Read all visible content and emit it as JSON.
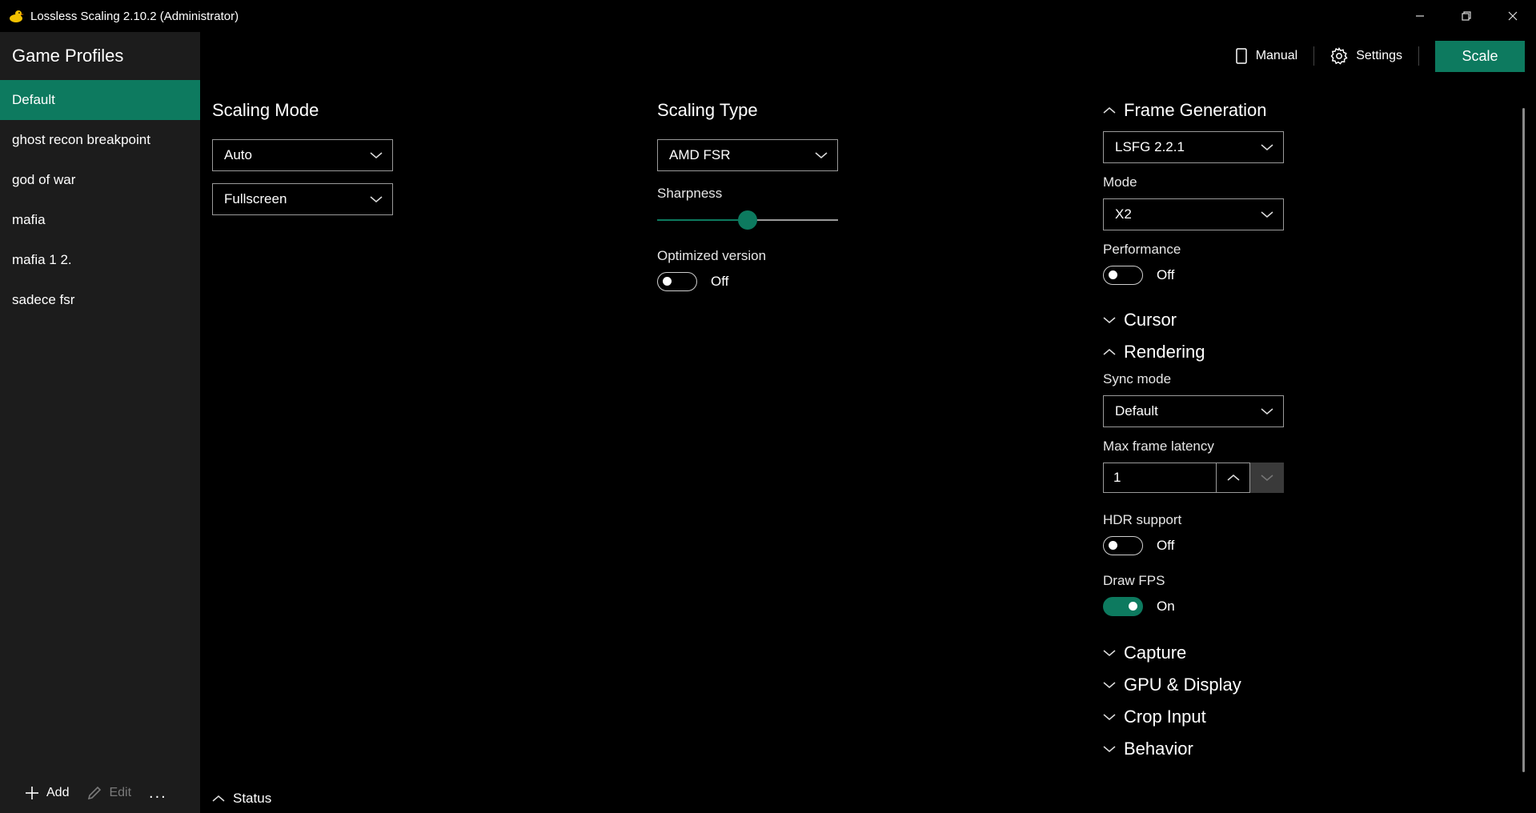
{
  "window": {
    "title": "Lossless Scaling 2.10.2 (Administrator)"
  },
  "sidebar": {
    "header": "Game Profiles",
    "profiles": [
      {
        "label": "Default",
        "active": true
      },
      {
        "label": "ghost recon breakpoint"
      },
      {
        "label": "god of war"
      },
      {
        "label": "mafia"
      },
      {
        "label": "mafia 1 2."
      },
      {
        "label": "sadece fsr"
      }
    ],
    "footer": {
      "add": "Add",
      "edit": "Edit",
      "more": "..."
    }
  },
  "toolbar": {
    "manual": "Manual",
    "settings": "Settings",
    "scale": "Scale"
  },
  "scaling_mode": {
    "title": "Scaling Mode",
    "mode_value": "Auto",
    "display_value": "Fullscreen"
  },
  "scaling_type": {
    "title": "Scaling Type",
    "type_value": "AMD FSR",
    "sharpness_label": "Sharpness",
    "sharpness_fraction": 0.5,
    "optimized_label": "Optimized version",
    "optimized_state": "Off"
  },
  "frame_generation": {
    "title": "Frame Generation",
    "version_value": "LSFG 2.2.1",
    "mode_label": "Mode",
    "mode_value": "X2",
    "performance_label": "Performance",
    "performance_state": "Off"
  },
  "cursor": {
    "title": "Cursor"
  },
  "rendering": {
    "title": "Rendering",
    "sync_label": "Sync mode",
    "sync_value": "Default",
    "latency_label": "Max frame latency",
    "latency_value": "1",
    "hdr_label": "HDR support",
    "hdr_state": "Off",
    "fps_label": "Draw FPS",
    "fps_state": "On"
  },
  "collapsed_sections": [
    "Capture",
    "GPU & Display",
    "Crop Input",
    "Behavior"
  ],
  "status": {
    "label": "Status"
  },
  "colors": {
    "accent": "#0d7a5f",
    "sidebar_bg": "#1c1c1c",
    "background": "#000000"
  }
}
